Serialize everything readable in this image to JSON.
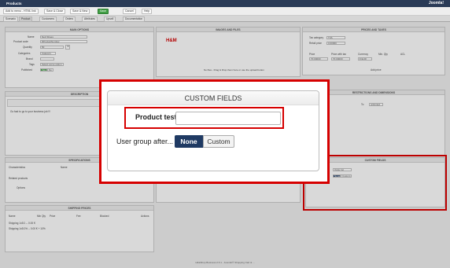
{
  "window": {
    "title": "Products",
    "brand": "Joomla!"
  },
  "toolbar": {
    "btn1": "Add to menu - HTML link",
    "btn2": "Save & Close",
    "btn3": "Save & New",
    "btn4": "Save",
    "btn5": "Cancel",
    "btn6": "Help"
  },
  "tabs": {
    "t1": "Scenario",
    "t2": "Product",
    "t3": "Customers",
    "t4": "Orders",
    "t5": "Attributes",
    "t6": "Upsell",
    "t7": "Documentation"
  },
  "main_options": {
    "title": "MAIN OPTIONS",
    "name_label": "Name",
    "name_value": "Nett Shoes",
    "code_label": "Product code",
    "code_value": "#ProductNumber",
    "qty_label": "Quantity",
    "qty_value": "50",
    "cat_label": "Categories",
    "cat_value": "Category",
    "brand_label": "Brand",
    "tags_label": "Tags",
    "tags_value": "Select some option",
    "pub_label": "Published",
    "pub_yes": "Yes",
    "pub_no": "No"
  },
  "images": {
    "title": "IMAGES AND FILES",
    "brand_logo": "H&M",
    "hint": "No files - Drag & Drop them here or use the upload button"
  },
  "prices": {
    "title": "PRICES AND TAXES",
    "taxcat_label": "Tax category",
    "taxcat_value": "TVA",
    "retail_label": "Retail price",
    "retail_value": "0.00000",
    "price_label": "Price",
    "pwt_label": "Price with tax",
    "currency_label": "Currency",
    "minqty_label": "Min. Qty",
    "acl_label": "ACL",
    "price_value": "70.00000",
    "pwt_value": "70.00000",
    "currency_value": "€ EUR",
    "addprice": "Add price"
  },
  "description": {
    "title": "DESCRIPTION",
    "text": "Go fast to go to your business job !!!"
  },
  "restrictions": {
    "title": "RESTRICTIONS AND DIMENSIONS",
    "to_label": "To",
    "to_value": "unlimited"
  },
  "specs": {
    "title": "SPECIFICATIONS",
    "char_label": "Characteristics",
    "name_col": "Name",
    "related_label": "Related products",
    "options_label": "Options"
  },
  "shipping": {
    "title": "SHIPPING PRICES",
    "col1": "Name",
    "col2": "Min Qty",
    "col3": "Price",
    "col4": "Fee",
    "col5": "Blocked",
    "col6": "Actions",
    "row1": "Shipping 1x3/1 -- 0.00 €",
    "row2": "Shipping 1x3/1% -- 0.00 € + 10%"
  },
  "custom_fields_panel": {
    "title": "CUSTOM FIELDS",
    "label": "Product test",
    "value": "Quite 1st",
    "none": "None",
    "custom": "Custom"
  },
  "modal": {
    "title": "CUSTOM FIELDS",
    "product_test_label": "Product test",
    "user_group_label": "User group after...",
    "none_label": "None",
    "custom_label": "Custom"
  },
  "footer": "HikaShop Business 2.6.1 - Joomla!® Shopping Cart & ..."
}
